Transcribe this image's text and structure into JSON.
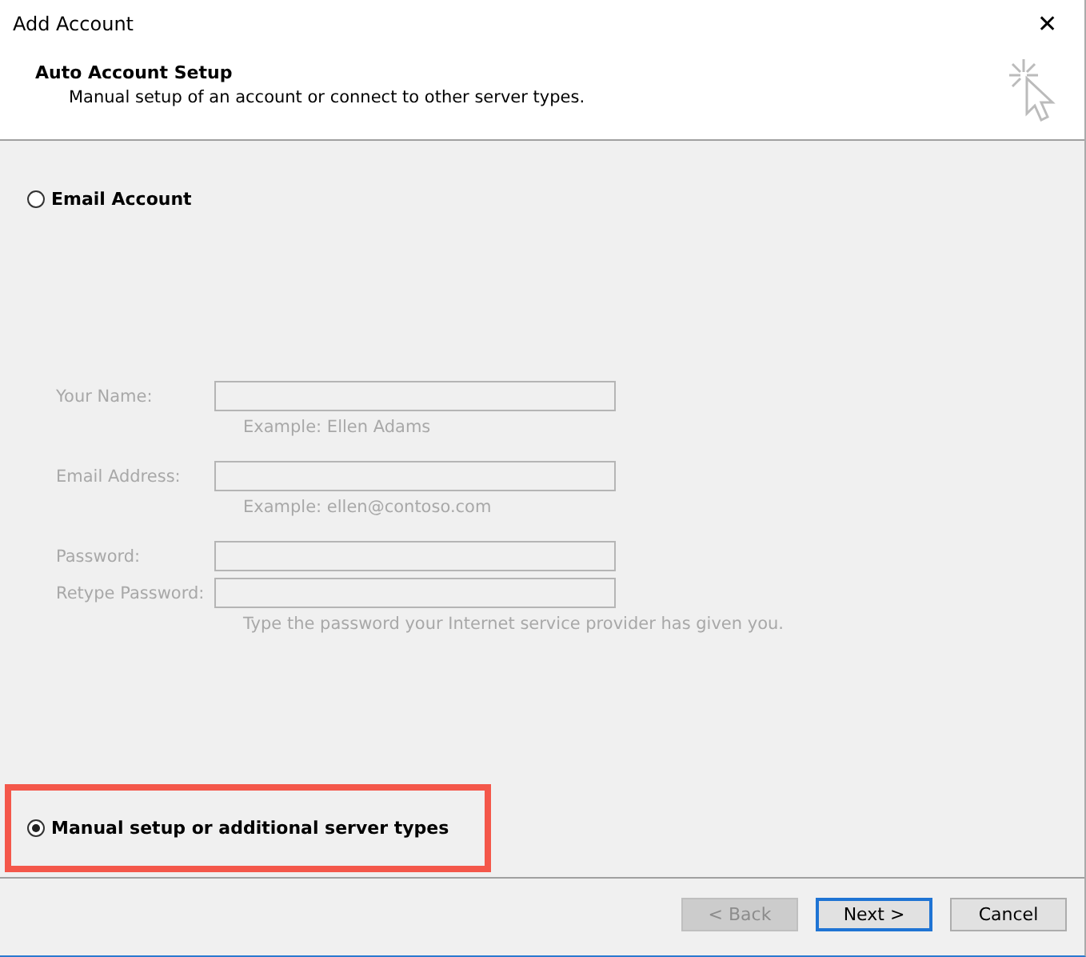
{
  "window": {
    "title": "Add Account",
    "close": "✕"
  },
  "header": {
    "title": "Auto Account Setup",
    "subtitle": "Manual setup of an account or connect to other server types."
  },
  "options": [
    {
      "label": "Email Account",
      "selected": false,
      "highlighted": false
    },
    {
      "label": "Manual setup or additional server types",
      "selected": true,
      "highlighted": true
    }
  ],
  "form": {
    "disabled": true,
    "fields": [
      {
        "label": "Your Name:",
        "hint": "Example: Ellen Adams"
      },
      {
        "label": "Email Address:",
        "hint": "Example: ellen@contoso.com"
      },
      {
        "label": "Password:"
      },
      {
        "label": "Retype Password:",
        "hint": "Type the password your Internet service provider has given you."
      }
    ]
  },
  "buttons": [
    {
      "label": "< Back",
      "disabled": true,
      "default": false
    },
    {
      "label": "Next >",
      "disabled": false,
      "default": true
    },
    {
      "label": "Cancel",
      "disabled": false,
      "default": false
    }
  ]
}
